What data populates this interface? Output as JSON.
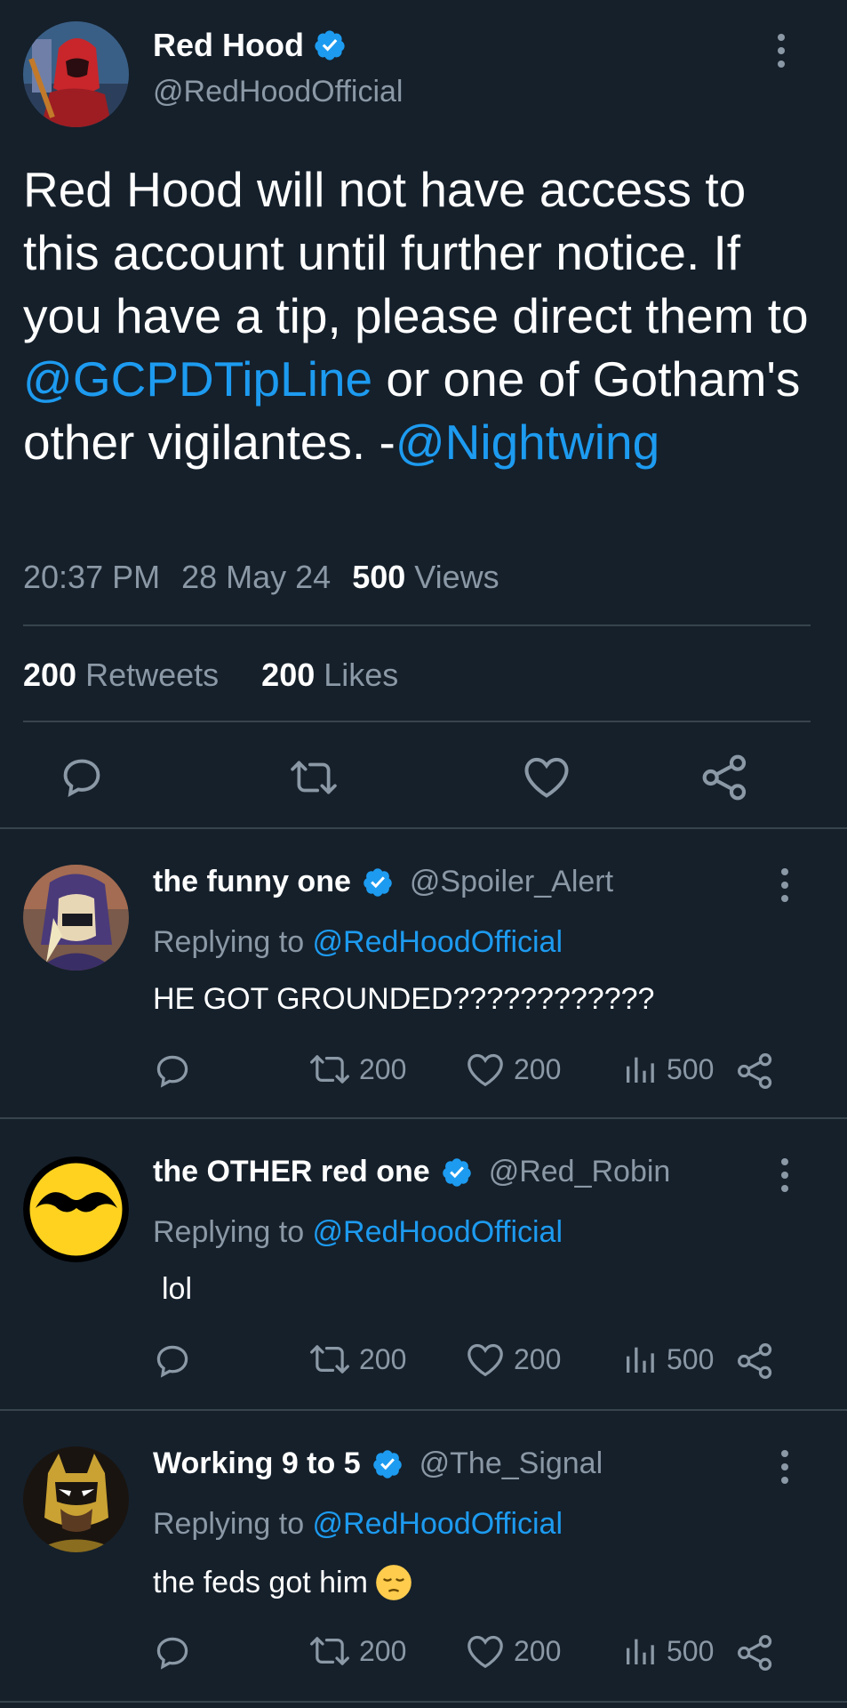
{
  "main_tweet": {
    "display_name": "Red Hood",
    "handle": "@RedHoodOfficial",
    "text_1": "Red Hood will not have access to this account until further notice. If you have a tip, please direct them to ",
    "mention_1": "@GCPDTipLine",
    "text_2": " or one of Gotham's other vigilantes. -",
    "mention_2": "@Nightwing",
    "time": "20:37 PM",
    "date": "28 May 24",
    "views_count": "500",
    "views_label": "Views",
    "retweets_count": "200",
    "retweets_label": "Retweets",
    "likes_count": "200",
    "likes_label": "Likes"
  },
  "replies": [
    {
      "display_name": "the funny one",
      "handle": "@Spoiler_Alert",
      "replying_label": "Replying to ",
      "replying_to": "@RedHoodOfficial",
      "text": "HE GOT GROUNDED????????????",
      "retweets": "200",
      "likes": "200",
      "views": "500"
    },
    {
      "display_name": "the OTHER red one",
      "handle": "@Red_Robin",
      "replying_label": "Replying to ",
      "replying_to": "@RedHoodOfficial",
      "text": "lol",
      "retweets": "200",
      "likes": "200",
      "views": "500"
    },
    {
      "display_name": "Working 9 to 5",
      "handle": "@The_Signal",
      "replying_label": "Replying to ",
      "replying_to": "@RedHoodOfficial",
      "text": "the feds got him",
      "emoji": "pensive-face",
      "retweets": "200",
      "likes": "200",
      "views": "500"
    }
  ],
  "colors": {
    "background": "#15202b",
    "accent": "#1d9bf0",
    "muted": "#8b98a5",
    "divider": "#38444d"
  }
}
